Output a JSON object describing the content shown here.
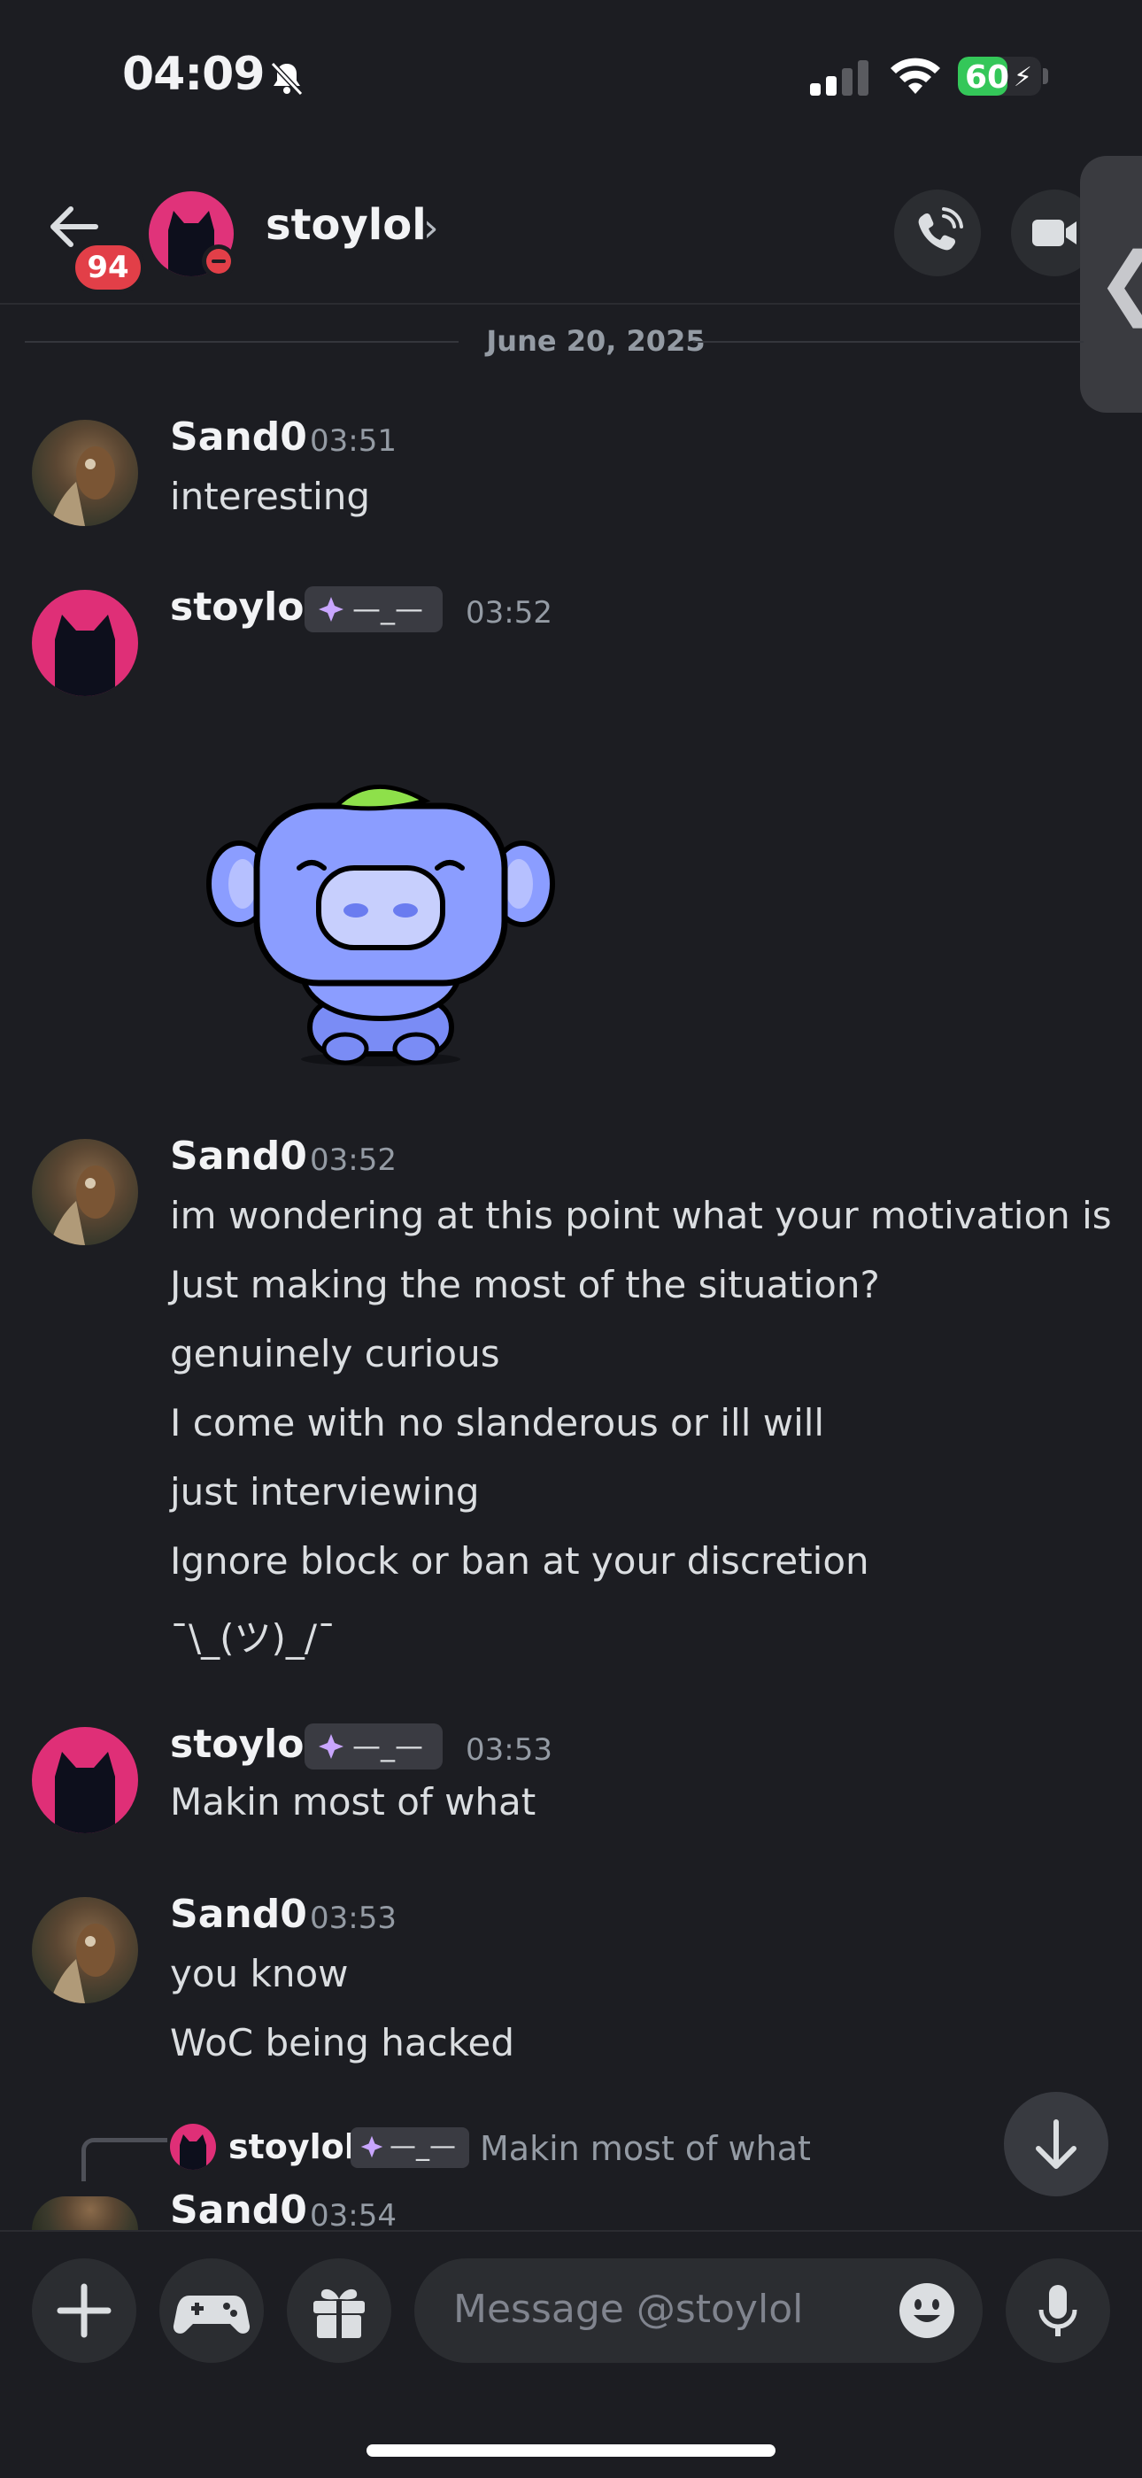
{
  "status_bar": {
    "time": "04:09",
    "battery": "60",
    "battery_level": 0.6
  },
  "header": {
    "back_badge": "94",
    "name": "stoylol",
    "chevron": "›",
    "side_tab_glyph": "❮"
  },
  "divider": {
    "date": "June 20, 2025"
  },
  "messages": [
    {
      "author": "Sand0",
      "time": "03:51",
      "lines": [
        "interesting"
      ]
    },
    {
      "author": "stoylol",
      "tag": "—_—",
      "time": "03:52",
      "lines": []
    },
    {
      "author": "Sand0",
      "time": "03:52",
      "lines": [
        "im wondering at this point what your motivation is",
        "Just making the most of the situation?",
        "genuinely curious",
        "I come with no slanderous or ill will",
        "just interviewing",
        "Ignore block or ban at your discretion",
        "¯\\_(ツ)_/¯"
      ]
    },
    {
      "author": "stoylol",
      "tag": "—_—",
      "time": "03:53",
      "lines": [
        "Makin most of what"
      ]
    },
    {
      "author": "Sand0",
      "time": "03:53",
      "lines": [
        "you know",
        "WoC being hacked"
      ]
    },
    {
      "author": "Sand0",
      "time": "03:54",
      "lines": []
    }
  ],
  "reply": {
    "author": "stoylol",
    "tag": "—_—",
    "text": "Makin most of what"
  },
  "composer": {
    "placeholder": "Message @stoylol"
  }
}
